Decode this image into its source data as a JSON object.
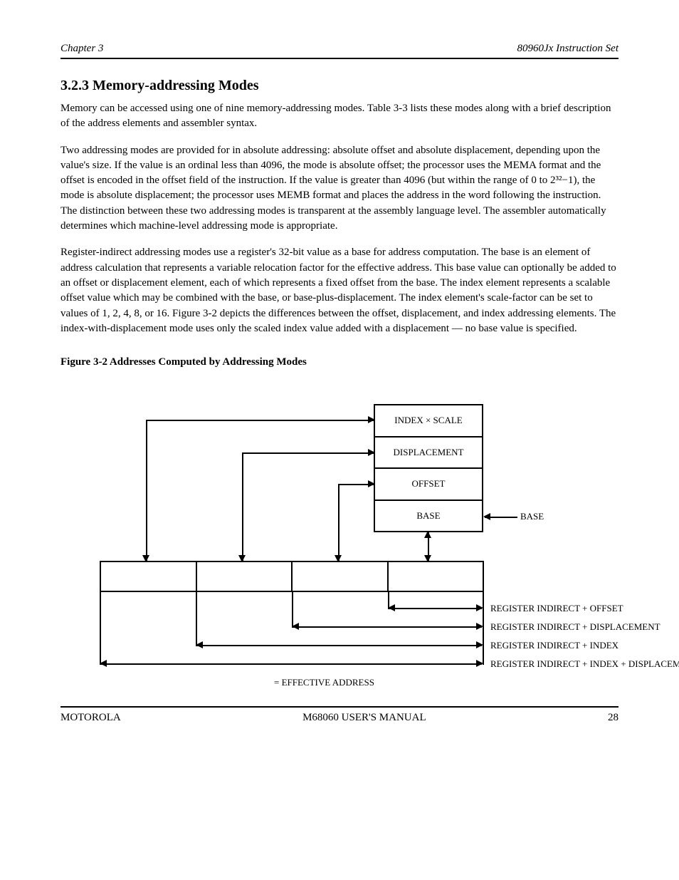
{
  "header": {
    "chapter": "Chapter 3",
    "title": "80960Jx Instruction Set"
  },
  "sections": {
    "addressing": {
      "heading": "3.2.3 Memory-addressing Modes",
      "p1": "Memory can be accessed using one of nine memory-addressing modes. Table 3-3 lists these modes along with a brief description of the address elements and assembler syntax.",
      "p2": "Two addressing modes are provided for in absolute addressing: absolute offset and absolute displacement, depending upon the value's size. If the value is an ordinal less than 4096, the mode is absolute offset; the processor uses the MEMA format and the offset is encoded in the offset field of the instruction. If the value is greater than 4096 (but within the range of 0 to 2³²−1), the mode is absolute displacement; the processor uses MEMB format and places the address in the word following the instruction. The distinction between these two addressing modes is transparent at the assembly language level. The assembler automatically determines which machine-level addressing mode is appropriate.",
      "p3": "Register-indirect addressing modes use a register's 32-bit value as a base for address computation. The base is an element of address calculation that represents a variable relocation factor for the effective address. This base value can optionally be added to an offset or displacement element, each of which represents a fixed offset from the base. The index element represents a scalable offset value which may be combined with the base, or base-plus-displacement. The index element's scale-factor can be set to values of 1, 2, 4, 8, or 16. Figure 3-2 depicts the differences between the offset, displacement, and index addressing elements. The index-with-displacement mode uses only the scaled index value added with a displacement — no base value is specified."
    }
  },
  "figure": {
    "caption": "Figure 3-2  Addresses Computed by Addressing Modes",
    "stack": [
      "INDEX × SCALE",
      "DISPLACEMENT",
      "OFFSET",
      "BASE"
    ],
    "hcells": [
      "",
      "",
      "",
      ""
    ],
    "ea_line": "= EFFECTIVE ADDRESS",
    "baseLabel": "BASE",
    "modes": {
      "m1": "REGISTER INDIRECT + OFFSET",
      "m2": "REGISTER INDIRECT + DISPLACEMENT",
      "m3": "REGISTER INDIRECT + INDEX",
      "m4": "REGISTER INDIRECT + INDEX + DISPLACEMENT"
    }
  },
  "footer": {
    "left": "MOTOROLA",
    "left2": "28",
    "right_title": "M68060 USER'S MANUAL"
  }
}
